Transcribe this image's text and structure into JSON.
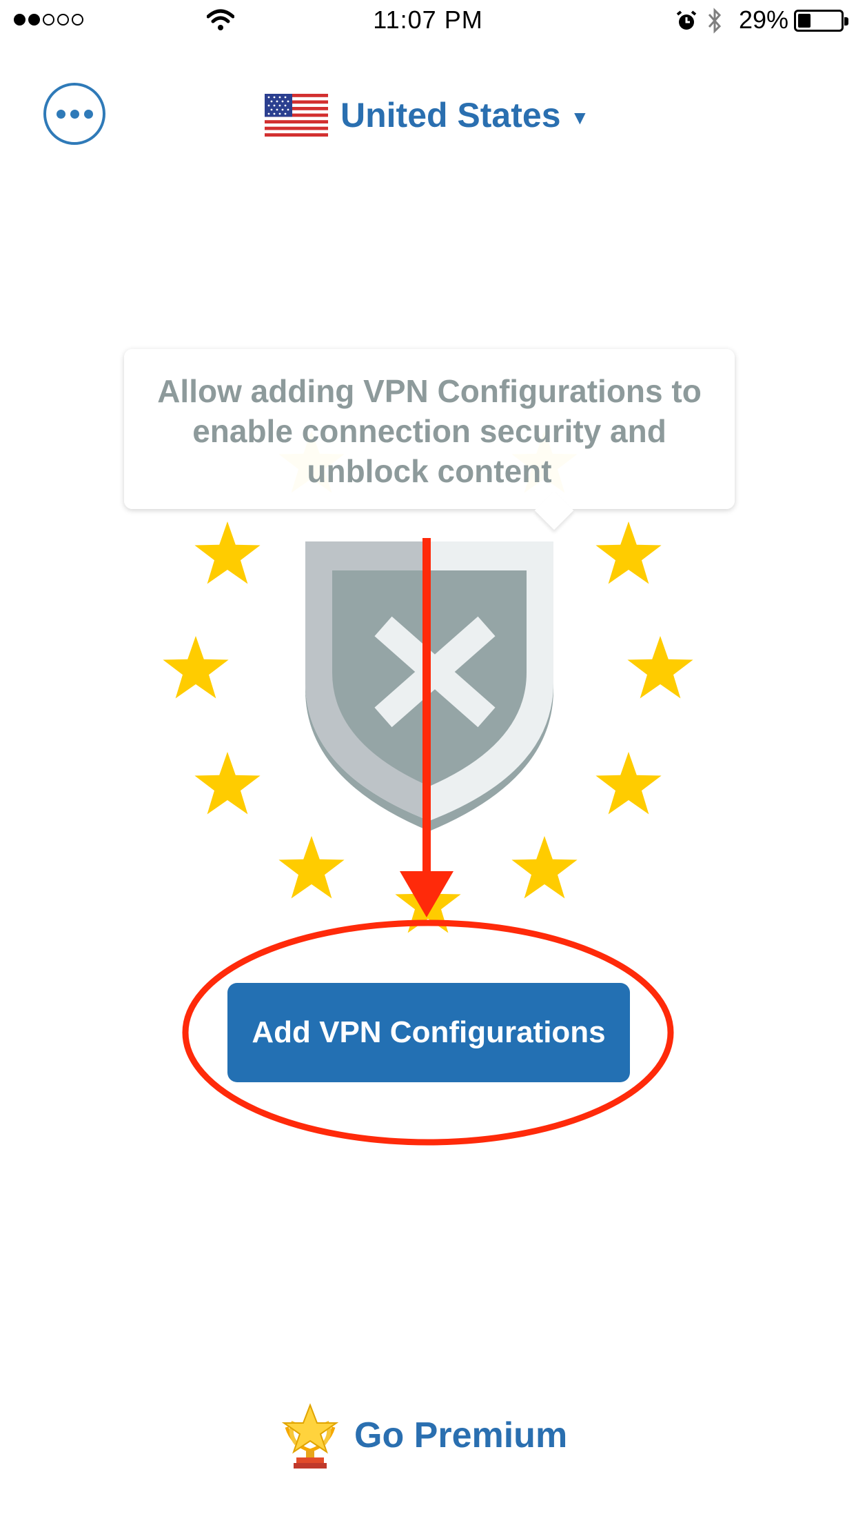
{
  "status_bar": {
    "time": "11:07 PM",
    "battery_percent": "29%",
    "signal_bars_filled": 2,
    "signal_bars_total": 5,
    "battery_level": 0.29,
    "icons": [
      "signal-dots-icon",
      "wifi-icon",
      "alarm-icon",
      "bluetooth-icon",
      "battery-icon"
    ]
  },
  "header": {
    "menu_icon": "more-dots-icon",
    "country": "United States",
    "country_flag": "us-flag-icon",
    "dropdown_icon": "caret-down-icon"
  },
  "tooltip": {
    "lines": [
      "Allow adding VPN Configurations to",
      "enable connection security and",
      "unblock content"
    ]
  },
  "illustration": {
    "icon": "shield-x-icon",
    "stars": "star-icon"
  },
  "primary_action": {
    "label": "Add VPN Configurations"
  },
  "footer": {
    "premium_label": "Go Premium",
    "premium_icon": "trophy-star-icon"
  },
  "annotations": {
    "arrow": "red-arrow",
    "highlight": "red-ellipse"
  },
  "colors": {
    "accent": "#2a6fb0",
    "button": "#2370b3",
    "star": "#ffcc00",
    "shield": "#95a5a6",
    "annotation": "#ff2a0a"
  }
}
